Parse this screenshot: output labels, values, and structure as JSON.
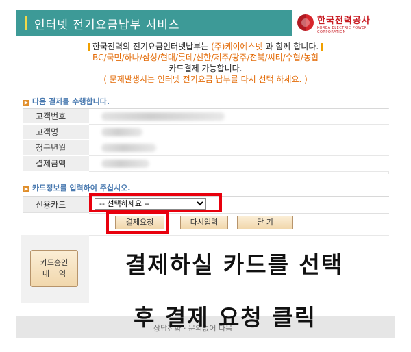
{
  "header": {
    "title": "인터넷 전기요금납부 서비스",
    "logo_ko": "한국전력공사",
    "logo_en": "KOREA ELECTRIC POWER CORPORATION"
  },
  "intro": {
    "line1_pre": "한국전력의 전기요금인터넷납부는 ",
    "line1_company": "(주)케이에스넷",
    "line1_post": " 과 함께 합니다.",
    "line2": "BC/국민/하나/삼성/현대/롯데/신한/제주/광주/전북/씨티/수협/농협",
    "line3": "카드결제 가능합니다.",
    "line4": "( 문제발생시는 인터넷 전기요금 납부를 다시 선택 하세요. )"
  },
  "section1": {
    "heading": "다음 결제를 수행합니다.",
    "rows": [
      {
        "label": "고객번호"
      },
      {
        "label": "고객명"
      },
      {
        "label": "청구년월"
      },
      {
        "label": "결제금액"
      }
    ]
  },
  "section2": {
    "heading": "카드정보를 입력하여 주십시오.",
    "card_label": "신용카드",
    "card_select_value": "-- 선택하세요 --"
  },
  "buttons": {
    "pay": "결제요청",
    "reset": "다시입력",
    "close": "닫 기"
  },
  "result": {
    "approve_line1": "카드승인",
    "approve_line2": "내    역"
  },
  "footer": {
    "text": "상담전화 · 문의없어 다음"
  },
  "overlay": {
    "line1": "결제하실 카드를 선택",
    "line2": "후 결제 요청 클릭"
  },
  "colors": {
    "header_bg": "#3d9a97",
    "accent_orange": "#e36c09",
    "heading_blue": "#4a7ab0",
    "highlight_red": "#e8000d"
  }
}
